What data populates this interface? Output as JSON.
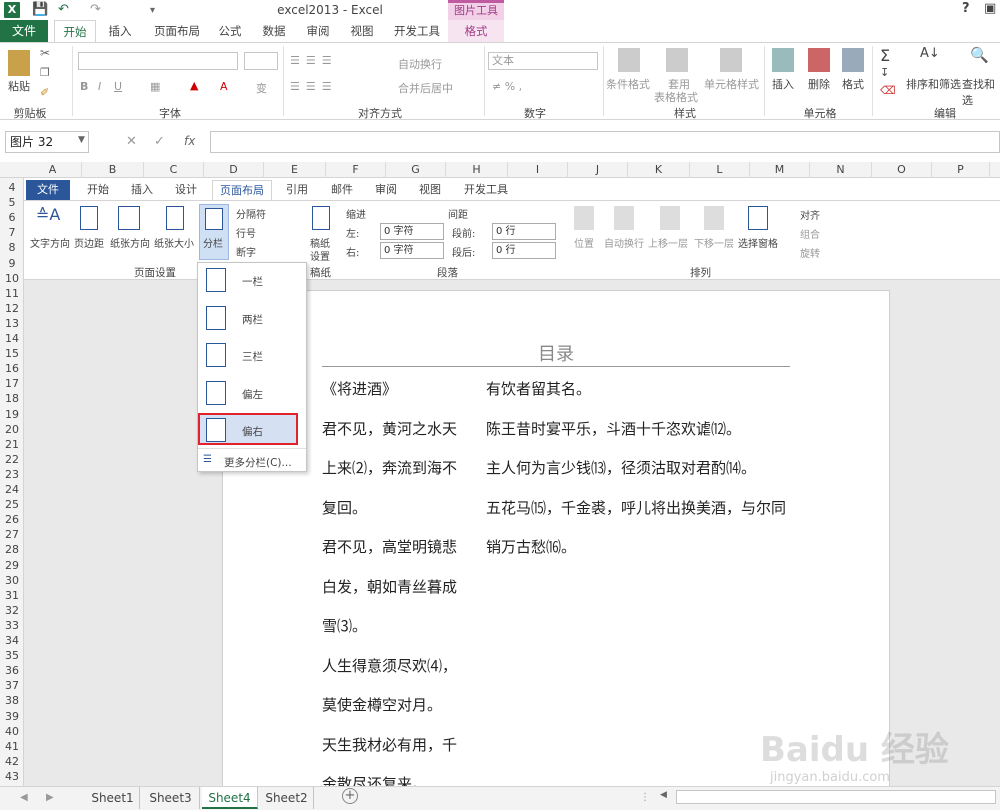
{
  "titlebar": {
    "title": "excel2013 - Excel",
    "context_group": "图片工具",
    "help": "?"
  },
  "tabs": [
    "文件",
    "开始",
    "插入",
    "页面布局",
    "公式",
    "数据",
    "审阅",
    "视图",
    "开发工具",
    "格式"
  ],
  "ribbon": {
    "clipboard": {
      "paste": "粘贴",
      "label": "剪贴板"
    },
    "font": {
      "label": "字体"
    },
    "alignment": {
      "wrap": "自动换行",
      "merge": "合并后居中",
      "label": "对齐方式"
    },
    "number": {
      "format": "文本",
      "label": "数字"
    },
    "styles": {
      "cond": "条件格式",
      "table1": "套用",
      "table2": "表格格式",
      "cell": "单元格样式",
      "label": "样式"
    },
    "cells": {
      "insert": "插入",
      "delete": "删除",
      "format": "格式",
      "label": "单元格"
    },
    "editing": {
      "sort": "排序和筛选",
      "find": "查找和选",
      "label": "编辑"
    }
  },
  "formula_bar": {
    "name_box": "图片 32",
    "fx": "fx"
  },
  "columns": [
    "A",
    "B",
    "C",
    "D",
    "E",
    "F",
    "G",
    "H",
    "I",
    "J",
    "K",
    "L",
    "M",
    "N",
    "O",
    "P"
  ],
  "rows": [
    "4",
    "5",
    "6",
    "7",
    "8",
    "9",
    "10",
    "11",
    "12",
    "13",
    "14",
    "15",
    "16",
    "17",
    "18",
    "19",
    "20",
    "21",
    "22",
    "23",
    "24",
    "25",
    "26",
    "27",
    "28",
    "29",
    "30",
    "31",
    "32",
    "33",
    "34",
    "35",
    "36",
    "37",
    "38",
    "39",
    "40",
    "41",
    "42",
    "43"
  ],
  "word": {
    "tabs": [
      "文件",
      "开始",
      "插入",
      "设计",
      "页面布局",
      "引用",
      "邮件",
      "审阅",
      "视图",
      "开发工具"
    ],
    "page_setup": {
      "text_dir": "文字方向",
      "margins": "页边距",
      "orientation": "纸张方向",
      "size": "纸张大小",
      "columns": "分栏",
      "breaks": "分隔符",
      "line_numbers": "行号",
      "hyphen": "断字",
      "label": "页面设置"
    },
    "paper": {
      "btn1": "稿纸",
      "btn2": "设置",
      "label": "稿纸"
    },
    "paragraph": {
      "indent": "缩进",
      "spacing": "间距",
      "left": "左:",
      "right": "右:",
      "before": "段前:",
      "after": "段后:",
      "left_val": "0 字符",
      "right_val": "0 字符",
      "before_val": "0 行",
      "after_val": "0 行",
      "label": "段落"
    },
    "arrange": {
      "position": "位置",
      "wrap": "自动换行",
      "forward": "上移一层",
      "backward": "下移一层",
      "pane": "选择窗格",
      "align": "对齐",
      "group": "组合",
      "rotate": "旋转",
      "label": "排列"
    },
    "menu": {
      "items": [
        "一栏",
        "两栏",
        "三栏",
        "偏左",
        "偏右"
      ],
      "more": "更多分栏(C)..."
    },
    "doc": {
      "title": "目录",
      "left_col": [
        "《将进酒》",
        "君不见，黄河之水天",
        "上来⑵，奔流到海不",
        "复回。",
        "君不见，高堂明镜悲",
        "白发，朝如青丝暮成",
        "雪⑶。",
        "人生得意须尽欢⑷，",
        "莫使金樽空对月。",
        "天生我材必有用，千",
        "金散尽还复来。"
      ],
      "right_col": [
        "有饮者留其名。",
        "陈王昔时宴平乐，斗酒十千恣欢谑⑿。",
        "主人何为言少钱⒀，径须沽取对君酌⒁。",
        "五花马⒂，千金裘，呼儿将出换美酒，与尔同",
        "销万古愁⒃。"
      ]
    }
  },
  "sheets": [
    "Sheet1",
    "Sheet3",
    "Sheet4",
    "Sheet2"
  ],
  "active_sheet": "Sheet4",
  "watermark": {
    "brand": "Baidu 经验",
    "url": "jingyan.baidu.com"
  }
}
